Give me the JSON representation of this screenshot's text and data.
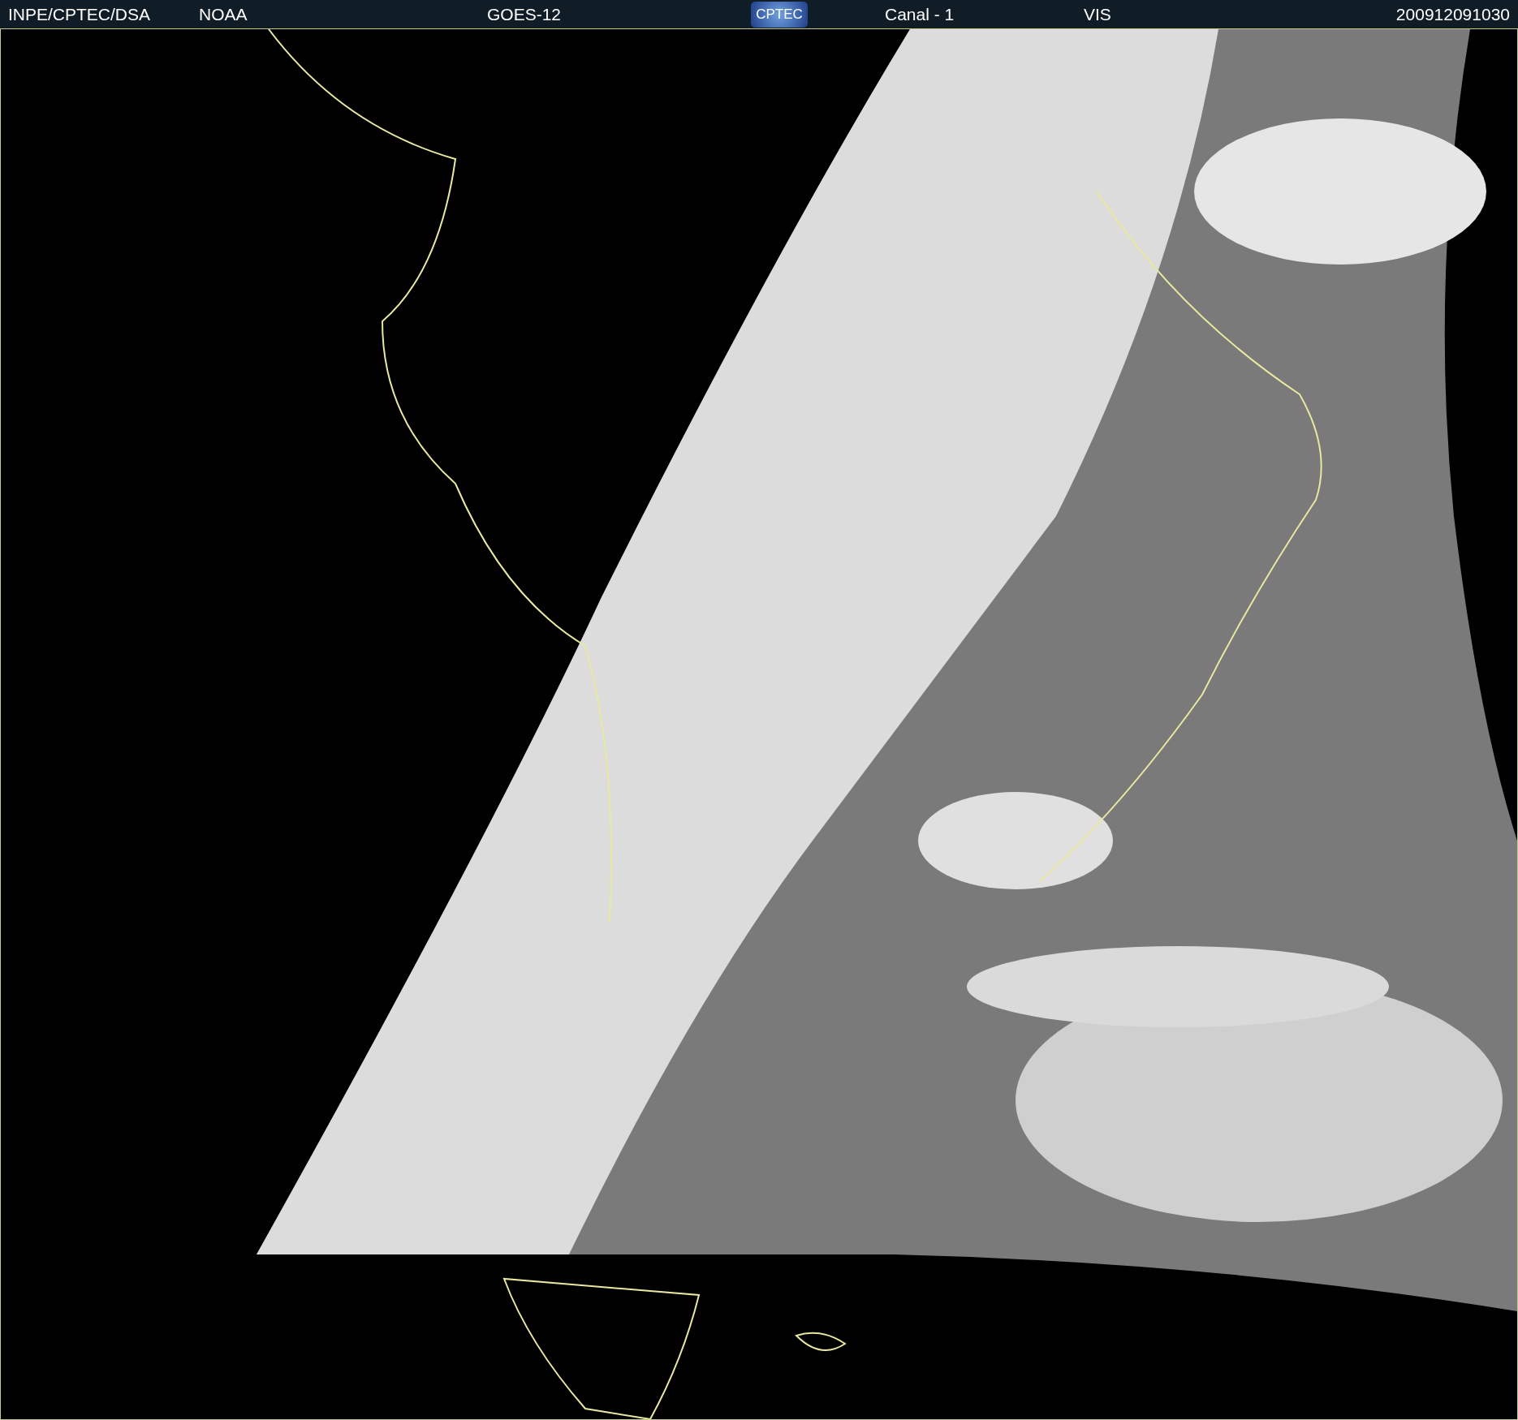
{
  "header": {
    "source": "INPE/CPTEC/DSA",
    "agency": "NOAA",
    "satellite": "GOES-12",
    "logo": "CPTEC",
    "channel": "Canal - 1",
    "band": "VIS",
    "timestamp": "200912091030"
  }
}
